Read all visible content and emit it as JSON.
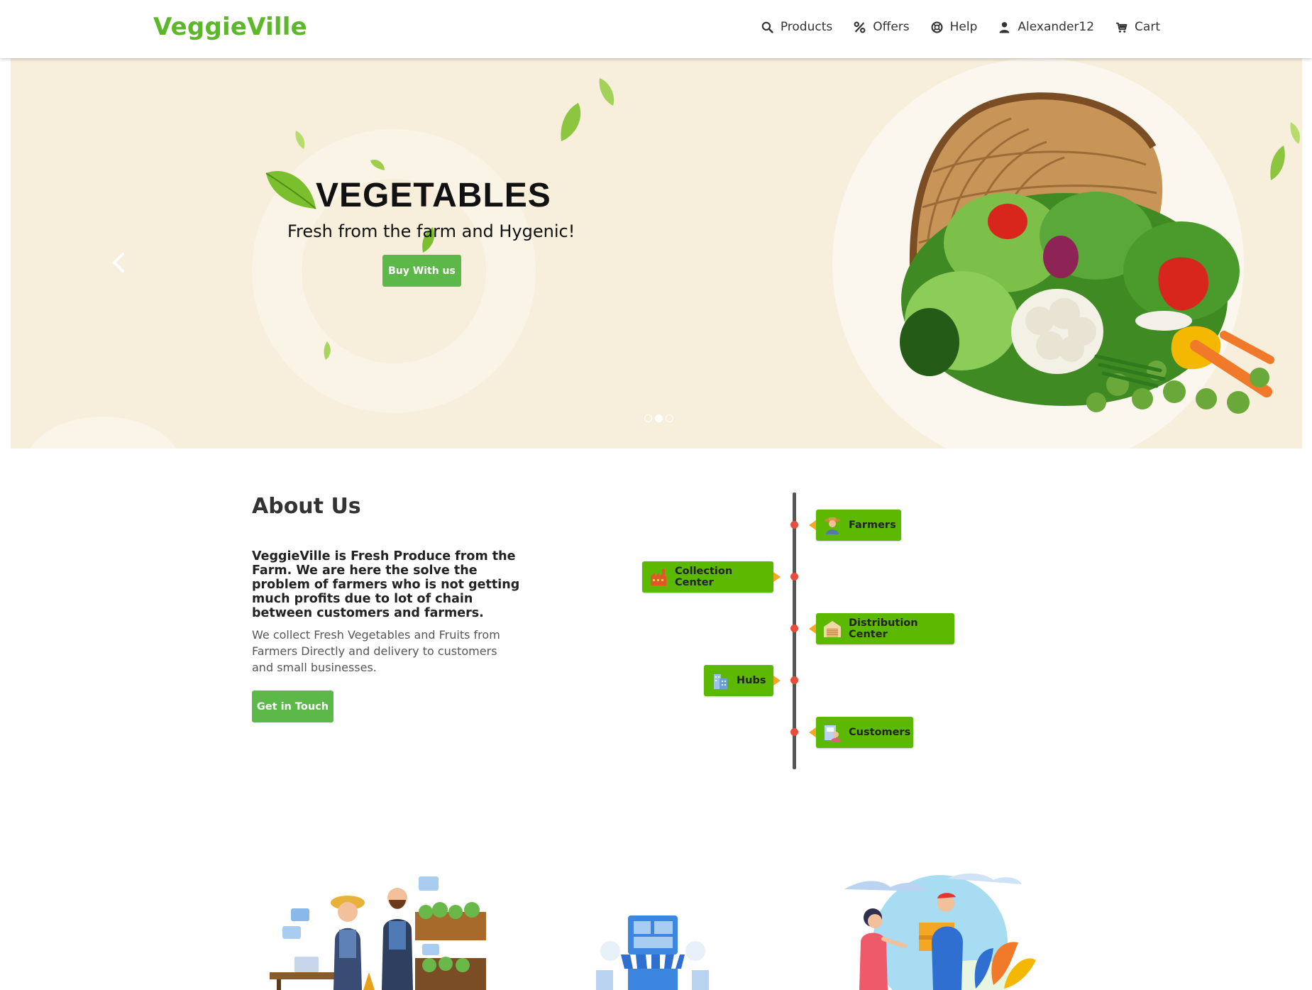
{
  "navbar": {
    "brand": "VeggieVille",
    "items": [
      {
        "label": "Products",
        "icon": "search-icon"
      },
      {
        "label": "Offers",
        "icon": "percent-icon"
      },
      {
        "label": "Help",
        "icon": "lifebuoy-icon"
      },
      {
        "label": "Alexander12",
        "icon": "user-icon"
      },
      {
        "label": "Cart",
        "icon": "cart-icon"
      }
    ]
  },
  "hero": {
    "title": "VEGETABLES",
    "subtitle": "Fresh from the farm and Hygenic!",
    "button_label": "Buy With us",
    "slides_count": 3,
    "active_slide": 2
  },
  "about": {
    "title": "About Us",
    "lead": "VeggieVille is Fresh Produce from the Farm. We are here the solve the problem of farmers who is not getting much profits due to lot of chain between customers and farmers.",
    "body": "We collect Fresh Vegetables and Fruits from Farmers Directly and delivery to customers and small businesses.",
    "button_label": "Get in Touch"
  },
  "timeline": [
    {
      "label": "Farmers",
      "side": "right",
      "icon": "farmer-icon"
    },
    {
      "label": "Collection Center",
      "side": "left",
      "icon": "factory-icon"
    },
    {
      "label": "Distribution Center",
      "side": "right",
      "icon": "warehouse-icon"
    },
    {
      "label": "Hubs",
      "side": "left",
      "icon": "hub-building-icon"
    },
    {
      "label": "Customers",
      "side": "right",
      "icon": "customer-icon"
    }
  ],
  "colors": {
    "brand": "#5cb82a",
    "button": "#5cb848",
    "timeline_card": "#5cb800",
    "timeline_dot": "#e74c3c",
    "hero_bg": "#f7eedb"
  }
}
